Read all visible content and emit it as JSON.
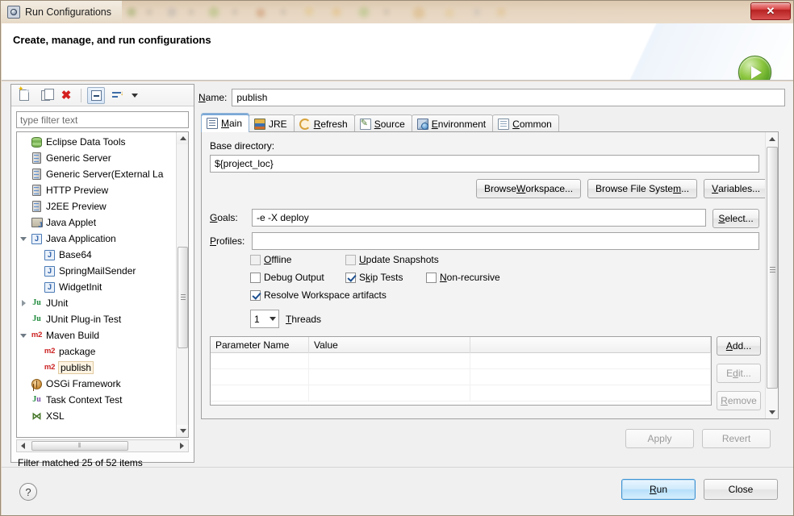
{
  "window": {
    "title": "Run Configurations",
    "title_icon": "run-configurations-icon",
    "close_label": "✕"
  },
  "header": {
    "title": "Create, manage, and run configurations",
    "icon": "green-run-play-icon"
  },
  "left_panel": {
    "toolbar": [
      {
        "name": "new-configuration-button",
        "icon": "new-document-icon",
        "tooltip": "New launch configuration"
      },
      {
        "name": "duplicate-configuration-button",
        "icon": "copy-icon",
        "tooltip": "Duplicate"
      },
      {
        "name": "delete-configuration-button",
        "icon": "red-x-delete-icon",
        "tooltip": "Delete"
      },
      {
        "name": "collapse-all-button",
        "icon": "collapse-all-icon",
        "tooltip": "Collapse All"
      },
      {
        "name": "filter-button",
        "icon": "filter-sort-icon",
        "tooltip": "Filter"
      },
      {
        "name": "toolbar-menu-button",
        "icon": "chevron-down-icon",
        "tooltip": "View Menu"
      }
    ],
    "filter": {
      "placeholder": "type filter text",
      "value": ""
    },
    "tree": [
      {
        "label": "Eclipse Data Tools",
        "icon": "database-icon",
        "indent": 0,
        "twisty": "none",
        "selected": false
      },
      {
        "label": "Generic Server",
        "icon": "server-icon",
        "indent": 0,
        "twisty": "none",
        "selected": false
      },
      {
        "label": "Generic Server(External La",
        "icon": "server-icon",
        "indent": 0,
        "twisty": "none",
        "selected": false
      },
      {
        "label": "HTTP Preview",
        "icon": "server-icon",
        "indent": 0,
        "twisty": "none",
        "selected": false
      },
      {
        "label": "J2EE Preview",
        "icon": "server-icon",
        "indent": 0,
        "twisty": "none",
        "selected": false
      },
      {
        "label": "Java Applet",
        "icon": "java-applet-icon",
        "indent": 0,
        "twisty": "none",
        "selected": false
      },
      {
        "label": "Java Application",
        "icon": "java-icon",
        "indent": 0,
        "twisty": "open",
        "selected": false
      },
      {
        "label": "Base64",
        "icon": "java-icon",
        "indent": 1,
        "twisty": "none",
        "selected": false
      },
      {
        "label": "SpringMailSender",
        "icon": "java-icon",
        "indent": 1,
        "twisty": "none",
        "selected": false
      },
      {
        "label": "WidgetInit",
        "icon": "java-icon",
        "indent": 1,
        "twisty": "none",
        "selected": false
      },
      {
        "label": "JUnit",
        "icon": "junit-icon",
        "indent": 0,
        "twisty": "closed",
        "selected": false
      },
      {
        "label": "JUnit Plug-in Test",
        "icon": "junit-plugin-icon",
        "indent": 0,
        "twisty": "none",
        "selected": false
      },
      {
        "label": "Maven Build",
        "icon": "maven-m2-icon",
        "indent": 0,
        "twisty": "open",
        "selected": false
      },
      {
        "label": "package",
        "icon": "maven-m2-icon",
        "indent": 1,
        "twisty": "none",
        "selected": false
      },
      {
        "label": "publish",
        "icon": "maven-m2-icon",
        "indent": 1,
        "twisty": "none",
        "selected": true
      },
      {
        "label": "OSGi Framework",
        "icon": "osgi-icon",
        "indent": 0,
        "twisty": "none",
        "selected": false
      },
      {
        "label": "Task Context Test",
        "icon": "junit-task-icon",
        "indent": 0,
        "twisty": "none",
        "selected": false
      },
      {
        "label": "XSL",
        "icon": "xsl-icon",
        "indent": 0,
        "twisty": "none",
        "selected": false
      }
    ],
    "status": "Filter matched 25 of 52 items"
  },
  "right_panel": {
    "name_label": "Name:",
    "name_value": "publish",
    "tabs": [
      {
        "label": "Main",
        "icon": "main-tab-icon",
        "active": true
      },
      {
        "label": "JRE",
        "icon": "jre-tab-icon",
        "active": false
      },
      {
        "label": "Refresh",
        "icon": "refresh-tab-icon",
        "active": false
      },
      {
        "label": "Source",
        "icon": "source-tab-icon",
        "active": false
      },
      {
        "label": "Environment",
        "icon": "environment-tab-icon",
        "active": false
      },
      {
        "label": "Common",
        "icon": "common-tab-icon",
        "active": false
      }
    ],
    "main_tab": {
      "base_directory_label": "Base directory:",
      "base_directory_value": "${project_loc}",
      "browse_workspace_label": "Browse Workspace...",
      "browse_filesystem_label": "Browse File System...",
      "variables_label": "Variables...",
      "goals_label": "Goals:",
      "goals_value": "-e  -X deploy",
      "select_label": "Select...",
      "profiles_label": "Profiles:",
      "profiles_value": "",
      "checkboxes": [
        {
          "label": "Offline",
          "checked": false,
          "enabled": true
        },
        {
          "label": "Update Snapshots",
          "checked": false,
          "enabled": true
        },
        {
          "label": "Debug Output",
          "checked": false,
          "enabled": true
        },
        {
          "label": "Skip Tests",
          "checked": true,
          "enabled": true
        },
        {
          "label": "Non-recursive",
          "checked": false,
          "enabled": true
        },
        {
          "label": "Resolve Workspace artifacts",
          "checked": true,
          "enabled": true
        }
      ],
      "threads_value": "1",
      "threads_label": "Threads",
      "parameter_table": {
        "columns": [
          "Parameter Name",
          "Value"
        ],
        "rows": []
      },
      "add_label": "Add...",
      "edit_label": "Edit...",
      "remove_label": "Remove"
    },
    "apply_label": "Apply",
    "revert_label": "Revert"
  },
  "footer": {
    "help_icon": "question-mark-help-icon",
    "run_label": "Run",
    "close_label": "Close"
  },
  "colors": {
    "accent_blue": "#3c93d4",
    "run_green": "#8cc63f",
    "close_red": "#d84545",
    "maven_red": "#cc2222"
  }
}
